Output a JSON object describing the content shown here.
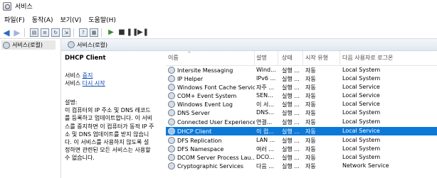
{
  "window": {
    "title": "서비스"
  },
  "menu": [
    "파일(F)",
    "동작(A)",
    "보기(V)",
    "도움말(H)"
  ],
  "toolbar": {
    "icons": [
      "back-arrow-icon",
      "forward-arrow-icon",
      "console-tree-icon",
      "list-icon",
      "refresh-icon",
      "export-icon",
      "help-icon",
      "properties-icon",
      "play-icon",
      "stop-icon",
      "pause-icon",
      "restart-icon"
    ]
  },
  "tree": {
    "root_label": "서비스(로컬)"
  },
  "pane_header": {
    "title": "서비스(로컬)"
  },
  "detail": {
    "service_name": "DHCP Client",
    "prefix": "서비스",
    "stop_link": "중지",
    "restart_link": "다시 시작",
    "desc_label": "설명:",
    "desc_lines": [
      "이 컴퓨터의 IP 주소 및 DNS 레코드",
      "를 등록하고 업데이트합니다. 이 서비",
      "스를 중지하면 이 컴퓨터가 동적 IP 주",
      "소 및 DNS 업데이트를 받지 않습니",
      "다. 이 서비스를 사용하지 않도록 설",
      "정하면 관련된 모든 서비스는 사용할",
      "수 없습니다."
    ]
  },
  "columns": {
    "name": "이름",
    "desc": "설명",
    "status": "상태",
    "startup": "시작 유형",
    "logon": "다음 사용자로 로그온"
  },
  "rows": [
    {
      "name": "Intersite Messaging",
      "desc": "Wind...",
      "status": "실행 ...",
      "startup": "자동",
      "logon": "Local System"
    },
    {
      "name": "IP Helper",
      "desc": "IPv6 ...",
      "status": "실행 ...",
      "startup": "자동",
      "logon": "Local System"
    },
    {
      "name": "Windows Font Cache Service",
      "desc": "자주 ...",
      "status": "실행 ...",
      "startup": "자동",
      "logon": "Local Service"
    },
    {
      "name": "COM+ Event System",
      "desc": "SEN...",
      "status": "실행 ...",
      "startup": "자동",
      "logon": "Local Service"
    },
    {
      "name": "Windows Event Log",
      "desc": "이 서...",
      "status": "실행 ...",
      "startup": "자동",
      "logon": "Local Service"
    },
    {
      "name": "DNS Server",
      "desc": "DNS...",
      "status": "실행 ...",
      "startup": "자동",
      "logon": "Local System"
    },
    {
      "name": "Connected User Experience...",
      "desc": "연결...",
      "status": "실행 ...",
      "startup": "자동",
      "logon": "Local System"
    },
    {
      "name": "DHCP Client",
      "desc": "이 컴...",
      "status": "실행 ...",
      "startup": "자동",
      "logon": "Local Service",
      "selected": true
    },
    {
      "name": "DFS Replication",
      "desc": "LAN ...",
      "status": "실행 ...",
      "startup": "자동",
      "logon": "Local System"
    },
    {
      "name": "DFS Namespace",
      "desc": "여러 ...",
      "status": "실행 ...",
      "startup": "자동",
      "logon": "Local System"
    },
    {
      "name": "DCOM Server Process Lau...",
      "desc": "DCO...",
      "status": "실행 ...",
      "startup": "자동",
      "logon": "Local System"
    },
    {
      "name": "Cryptographic Services",
      "desc": "다음 ...",
      "status": "실행 ...",
      "startup": "자동",
      "logon": "Network Service"
    }
  ],
  "colors": {
    "selection": "#0c78d7",
    "link": "#0a47b5"
  }
}
